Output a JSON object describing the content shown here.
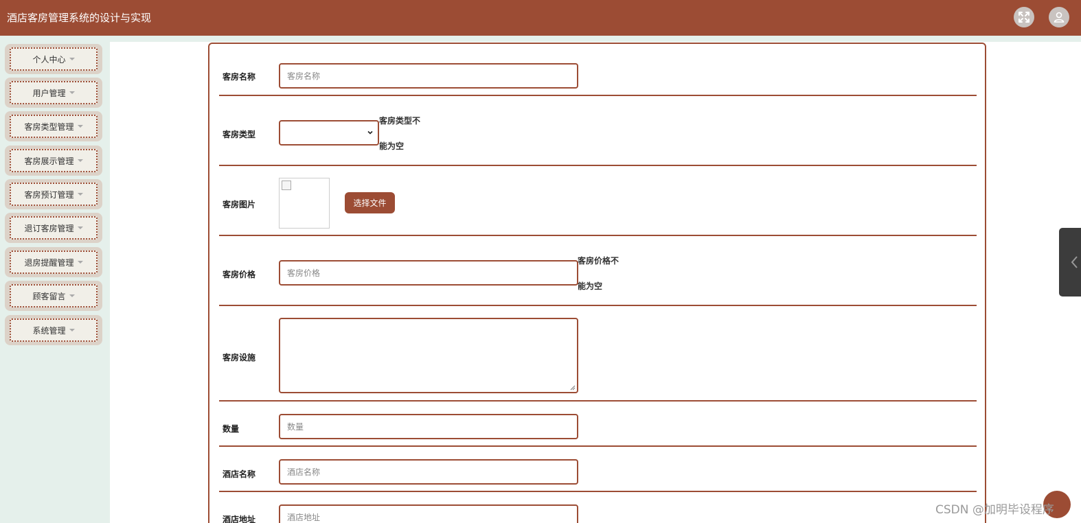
{
  "header": {
    "title": "酒店客房管理系统的设计与实现"
  },
  "sidebar": {
    "items": [
      {
        "label": "个人中心"
      },
      {
        "label": "用户管理"
      },
      {
        "label": "客房类型管理"
      },
      {
        "label": "客房展示管理"
      },
      {
        "label": "客房预订管理"
      },
      {
        "label": "退订客房管理"
      },
      {
        "label": "退房提醒管理"
      },
      {
        "label": "顾客留言"
      },
      {
        "label": "系统管理"
      }
    ]
  },
  "form": {
    "room_name": {
      "label": "客房名称",
      "placeholder": "客房名称"
    },
    "room_type": {
      "label": "客房类型",
      "error_line1": "客房类型不",
      "error_line2": "能为空"
    },
    "room_image": {
      "label": "客房图片",
      "button": "选择文件"
    },
    "room_price": {
      "label": "客房价格",
      "placeholder": "客房价格",
      "error_line1": "客房价格不",
      "error_line2": "能为空"
    },
    "room_facilities": {
      "label": "客房设施"
    },
    "quantity": {
      "label": "数量",
      "placeholder": "数量"
    },
    "hotel_name": {
      "label": "酒店名称",
      "placeholder": "酒店名称"
    },
    "hotel_address": {
      "label": "酒店地址",
      "placeholder": "酒店地址"
    }
  },
  "watermark": "CSDN @加明毕设程序",
  "colors": {
    "brand": "#9c4c34",
    "sidebar_bg": "#e5f0eb",
    "menu_bg": "#dcd2c8"
  },
  "icons": {
    "header_left": "expand-icon",
    "header_right": "user-icon",
    "side_tab": "chevron-left-icon"
  }
}
